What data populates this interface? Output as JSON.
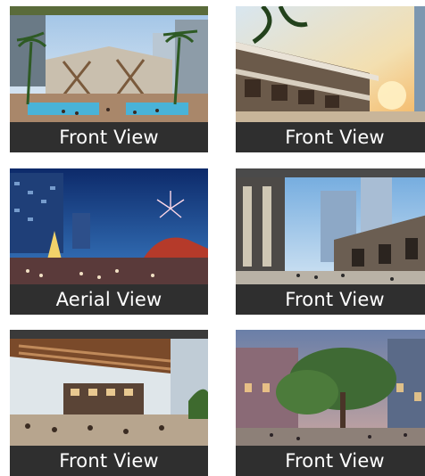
{
  "gallery": {
    "items": [
      {
        "caption": "Front View",
        "scene": "plaza-pool-icon"
      },
      {
        "caption": "Front View",
        "scene": "sunset-arcade-icon"
      },
      {
        "caption": "Aerial View",
        "scene": "night-fireworks-icon"
      },
      {
        "caption": "Front View",
        "scene": "street-towers-icon"
      },
      {
        "caption": "Front View",
        "scene": "dining-terrace-icon"
      },
      {
        "caption": "Front View",
        "scene": "evening-trees-icon"
      }
    ]
  },
  "colors": {
    "caption_bg": "#2f2f2f",
    "caption_text": "#ffffff",
    "card_top_band": "#5a6b3a"
  }
}
